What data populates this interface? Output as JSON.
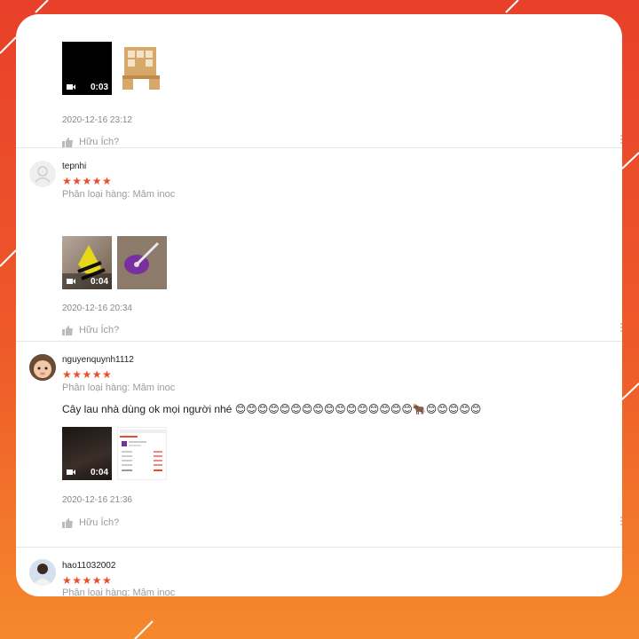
{
  "reviews": [
    {
      "username": "",
      "variation": "",
      "media": [
        {
          "type": "video",
          "duration": "0:03"
        },
        {
          "type": "image",
          "description": "wooden desk with shelves"
        }
      ],
      "timestamp": "2020-12-16 23:12",
      "helpful_label": "Hữu Ích?"
    },
    {
      "username": "tepnhi",
      "rating": 5,
      "stars": "★★★★★",
      "variation": "Phân loại hàng: Mâm inoc",
      "media": [
        {
          "type": "video",
          "duration": "0:04"
        },
        {
          "type": "image",
          "description": "purple spin mop"
        }
      ],
      "timestamp": "2020-12-16 20:34",
      "helpful_label": "Hữu Ích?"
    },
    {
      "username": "nguyenquynh1112",
      "rating": 5,
      "stars": "★★★★★",
      "variation": "Phân loại hàng: Mâm inoc",
      "comment": "Cây lau nhà dùng ok mọi người nhé 😊😊😊😊😊😊😊😊😊😊😊😊😊😊😊😊🐂😊😊😊😊😊",
      "media": [
        {
          "type": "video",
          "duration": "0:04"
        },
        {
          "type": "image",
          "description": "order screenshot"
        }
      ],
      "timestamp": "2020-12-16 21:36",
      "helpful_label": "Hữu Ích?"
    },
    {
      "username": "hao11032002",
      "rating": 5,
      "stars": "★★★★★",
      "variation": "Phân loại hàng: Mâm inoc"
    }
  ],
  "colors": {
    "accent": "#ee4d2d",
    "frame_top": "#e8402a",
    "frame_bottom": "#f5892c"
  },
  "icons": [
    "thumbs-up-icon",
    "video-camera-icon",
    "more-vertical-icon",
    "user-icon"
  ]
}
